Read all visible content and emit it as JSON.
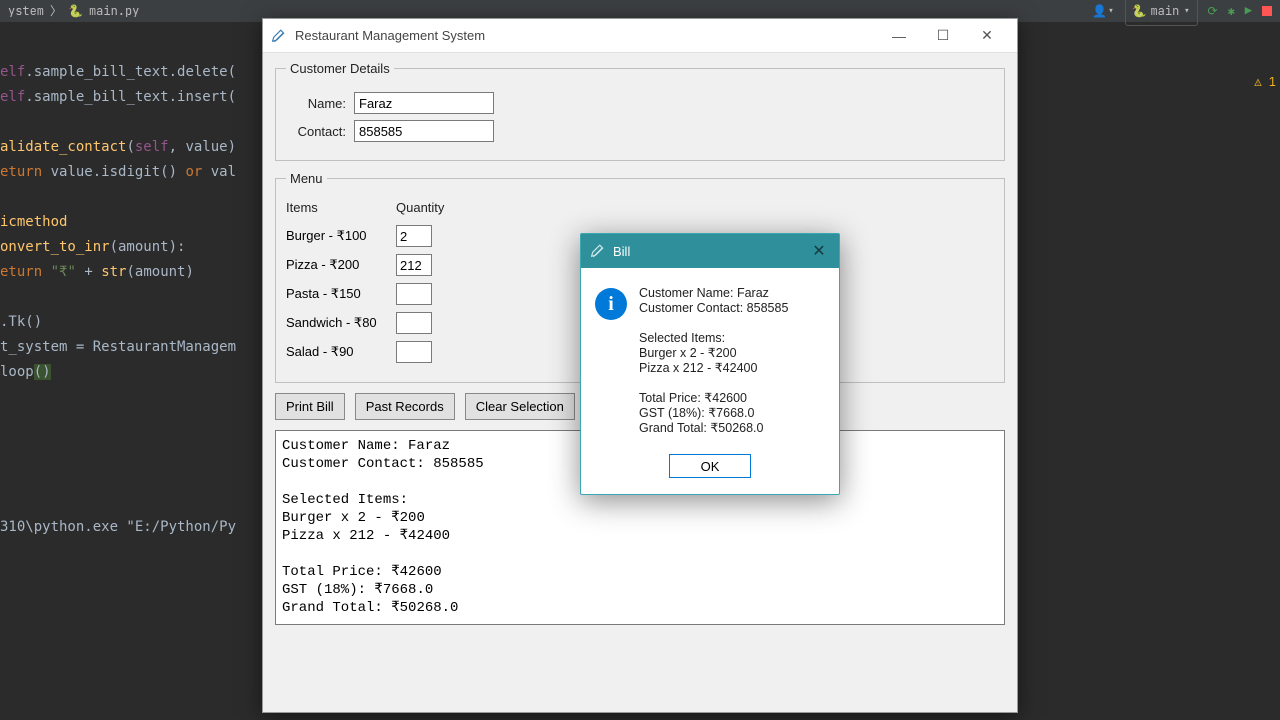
{
  "ide": {
    "breadcrumb_tail": "ystem",
    "tab_filename": "main.py",
    "run_config": "main",
    "warning_badge": "1",
    "code_lines": [
      "elf.sample_bill_text.delete(",
      "elf.sample_bill_text.insert(",
      "",
      "alidate_contact(self, value)",
      "eturn value.isdigit() or val",
      "",
      "icmethod",
      "onvert_to_inr(amount):",
      "eturn \"₹\" + str(amount)",
      "",
      ".Tk()",
      "t_system = RestaurantManagem",
      "loop()"
    ],
    "console_tail": "310\\python.exe \"E:/Python/Py"
  },
  "app": {
    "title": "Restaurant Management System",
    "customer_group": "Customer Details",
    "name_label": "Name:",
    "name_value": "Faraz",
    "contact_label": "Contact:",
    "contact_value": "858585",
    "menu_group": "Menu",
    "header_items": "Items",
    "header_qty": "Quantity",
    "items": [
      {
        "label": "Burger - ₹100",
        "qty": "2"
      },
      {
        "label": "Pizza - ₹200",
        "qty": "212"
      },
      {
        "label": "Pasta - ₹150",
        "qty": ""
      },
      {
        "label": "Sandwich - ₹80",
        "qty": ""
      },
      {
        "label": "Salad - ₹90",
        "qty": ""
      }
    ],
    "buttons": {
      "print_bill": "Print Bill",
      "past_records": "Past Records",
      "clear_selection": "Clear Selection"
    },
    "bill_text": "Customer Name: Faraz\nCustomer Contact: 858585\n\nSelected Items:\nBurger x 2 - ₹200\nPizza x 212 - ₹42400\n\nTotal Price: ₹42600\nGST (18%): ₹7668.0\nGrand Total: ₹50268.0"
  },
  "dialog": {
    "title": "Bill",
    "text": "Customer Name: Faraz\nCustomer Contact: 858585\n\nSelected Items:\nBurger x 2 - ₹200\nPizza x 212 - ₹42400\n\nTotal Price: ₹42600\nGST (18%): ₹7668.0\nGrand Total: ₹50268.0",
    "ok": "OK"
  }
}
